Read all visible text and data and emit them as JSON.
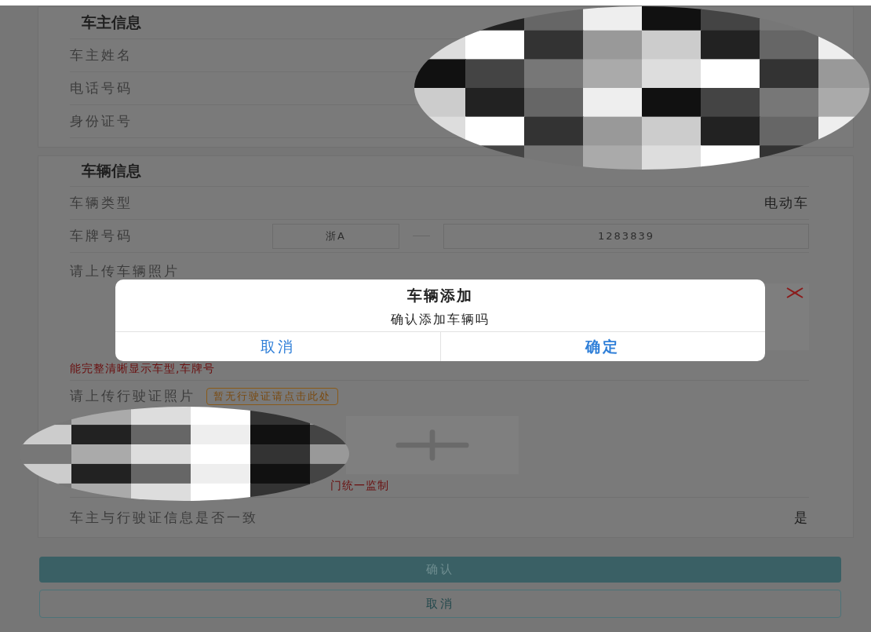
{
  "owner_section": {
    "title": "车主信息",
    "rows": [
      {
        "label": "车主姓名"
      },
      {
        "label": "电话号码"
      },
      {
        "label": "身份证号"
      }
    ]
  },
  "vehicle_section": {
    "title": "车辆信息",
    "vehicle_type": {
      "label": "车辆类型",
      "value": "电动车"
    },
    "plate": {
      "label": "车牌号码",
      "prefix": "浙A",
      "number": "1283839"
    },
    "vehicle_photo": {
      "label": "请上传车辆照片",
      "hint": "能完整清晰显示车型,车牌号"
    },
    "license_photo": {
      "label": "请上传行驶证照片",
      "tag": "暂无行驶证请点击此处",
      "hint": "门统一监制"
    },
    "consistency": {
      "label": "车主与行驶证信息是否一致",
      "value": "是"
    }
  },
  "buttons": [
    {
      "label": "确认",
      "kind": "primary"
    },
    {
      "label": "取消",
      "kind": "outline"
    }
  ],
  "dialog": {
    "title": "车辆添加",
    "message": "确认添加车辆吗",
    "buttons": [
      "取消",
      "确定"
    ]
  }
}
